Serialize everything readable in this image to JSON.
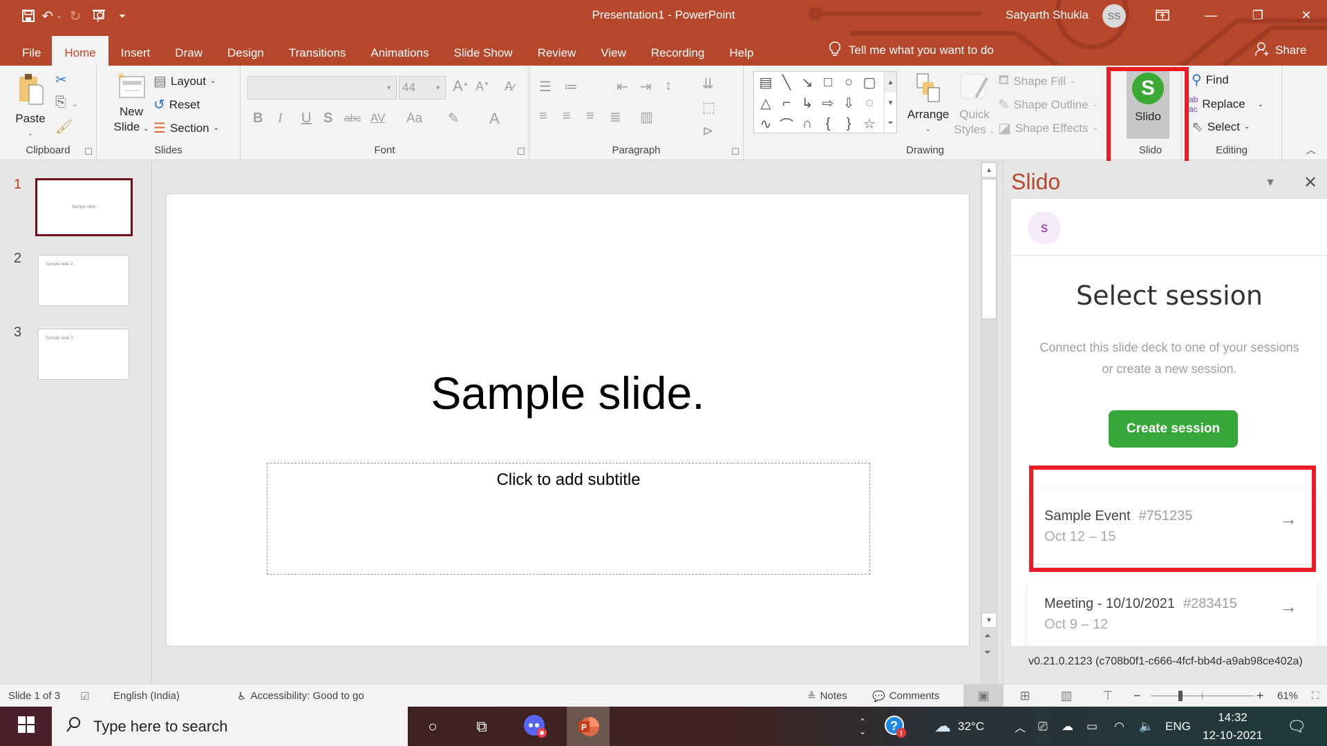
{
  "app": {
    "doc_title": "Presentation1  -  PowerPoint",
    "user_name": "Satyarth Shukla",
    "user_initials": "SS",
    "accent_color": "#b7472a"
  },
  "qat": {
    "save": "save-icon",
    "undo": "undo-icon",
    "redo": "redo-icon",
    "present": "present-from-start-icon",
    "customize": "customize-qat-icon"
  },
  "tabs": [
    {
      "label": "File"
    },
    {
      "label": "Home",
      "active": true
    },
    {
      "label": "Insert"
    },
    {
      "label": "Draw"
    },
    {
      "label": "Design"
    },
    {
      "label": "Transitions"
    },
    {
      "label": "Animations"
    },
    {
      "label": "Slide Show"
    },
    {
      "label": "Review"
    },
    {
      "label": "View"
    },
    {
      "label": "Recording"
    },
    {
      "label": "Help"
    }
  ],
  "tell_me": "Tell me what you want to do",
  "share_label": "Share",
  "ribbon": {
    "clipboard": {
      "label": "Clipboard",
      "paste": "Paste"
    },
    "slides": {
      "label": "Slides",
      "new_slide_1": "New",
      "new_slide_2": "Slide",
      "layout": "Layout",
      "reset": "Reset",
      "section": "Section"
    },
    "font": {
      "label": "Font",
      "font_name": "",
      "font_size": "44",
      "bold": "B",
      "italic": "I",
      "underline": "U",
      "shadow": "S",
      "strike": "abc",
      "spacing": "AV",
      "case": "Aa",
      "color": "A"
    },
    "paragraph": {
      "label": "Paragraph"
    },
    "drawing": {
      "label": "Drawing",
      "arrange": "Arrange",
      "quick_styles_1": "Quick",
      "quick_styles_2": "Styles",
      "shape_fill": "Shape Fill",
      "shape_outline": "Shape Outline",
      "shape_effects": "Shape Effects"
    },
    "slido": {
      "label": "Slido",
      "button": "Slido",
      "logo": "S"
    },
    "editing": {
      "label": "Editing",
      "find": "Find",
      "replace": "Replace",
      "select": "Select"
    }
  },
  "thumbnails": [
    {
      "num": "1",
      "text": "Sample slide.",
      "active": true
    },
    {
      "num": "2",
      "text": "Sample slide 2"
    },
    {
      "num": "3",
      "text": "Sample slide 3"
    }
  ],
  "slide": {
    "title": "Sample slide.",
    "subtitle_placeholder": "Click to add subtitle"
  },
  "slido_pane": {
    "title": "Slido",
    "avatar_initial": "s",
    "heading": "Select session",
    "description": "Connect this slide deck to one of your sessions or create a new session.",
    "create_button": "Create session",
    "sessions": [
      {
        "name": "Sample Event",
        "code": "#751235",
        "dates": "Oct 12 – 15",
        "highlighted": true
      },
      {
        "name": "Meeting - 10/10/2021",
        "code": "#283415",
        "dates": "Oct 9 – 12"
      }
    ],
    "version": "v0.21.0.2123 (c708b0f1-c666-4fcf-bb4d-a9ab98ce402a)",
    "brand_color": "#36a83a"
  },
  "status": {
    "slide_of": "Slide 1 of 3",
    "language": "English (India)",
    "accessibility": "Accessibility: Good to go",
    "notes": "Notes",
    "comments": "Comments",
    "zoom_percent": "61%",
    "zoom_value": 61
  },
  "taskbar": {
    "search_placeholder": "Type here to search",
    "temperature": "32°C",
    "language": "ENG",
    "time": "14:32",
    "date": "12-10-2021"
  }
}
